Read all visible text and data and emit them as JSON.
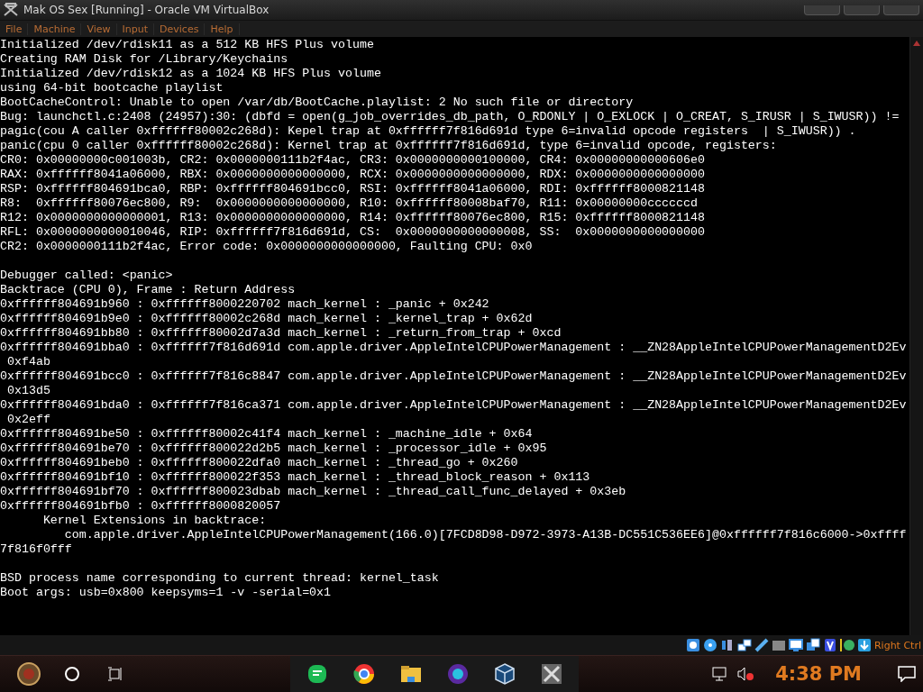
{
  "window": {
    "title": "Mak OS Sex [Running] - Oracle VM VirtualBox"
  },
  "menu": [
    "File",
    "Machine",
    "View",
    "Input",
    "Devices",
    "Help"
  ],
  "console": {
    "blocks": [
      [
        "Initialized /dev/rdisk11 as a 512 KB HFS Plus volume",
        "Creating RAM Disk for /Library/Keychains",
        "Initialized /dev/rdisk12 as a 1024 KB HFS Plus volume",
        "using 64-bit bootcache playlist",
        "BootCacheControl: Unable to open /var/db/BootCache.playlist: 2 No such file or directory",
        "Bug: launchctl.c:2408 (24957):30: (dbfd = open(g_job_overrides_db_path, O_RDONLY | O_EXLOCK | O_CREAT, S_IRUSR | S_IWUSR)) !=",
        "pagic(cou A caller 0xffffff80002c268d): Kepel trap at 0xffffff7f816d691d type 6=invalid opcode registers  | S_IWUSR)) .",
        "panic(cpu 0 caller 0xffffff80002c268d): Kernel trap at 0xffffff7f816d691d, type 6=invalid opcode, registers:",
        "CR0: 0x00000000c001003b, CR2: 0x0000000111b2f4ac, CR3: 0x0000000000100000, CR4: 0x00000000000606e0",
        "RAX: 0xffffff8041a06000, RBX: 0x0000000000000000, RCX: 0x0000000000000000, RDX: 0x0000000000000000",
        "RSP: 0xffffff804691bca0, RBP: 0xffffff804691bcc0, RSI: 0xffffff8041a06000, RDI: 0xffffff8000821148",
        "R8:  0xffffff80076ec800, R9:  0x0000000000000000, R10: 0xffffff80008baf70, R11: 0x00000000ccccccd",
        "R12: 0x0000000000000001, R13: 0x0000000000000000, R14: 0xffffff80076ec800, R15: 0xffffff8000821148",
        "RFL: 0x0000000000010046, RIP: 0xffffff7f816d691d, CS:  0x0000000000000008, SS:  0x0000000000000000",
        "CR2: 0x0000000111b2f4ac, Error code: 0x0000000000000000, Faulting CPU: 0x0"
      ],
      [
        "Debugger called: <panic>",
        "Backtrace (CPU 0), Frame : Return Address",
        "0xffffff804691b960 : 0xffffff8000220702 mach_kernel : _panic + 0x242",
        "0xffffff804691b9e0 : 0xffffff80002c268d mach_kernel : _kernel_trap + 0x62d",
        "0xffffff804691bb80 : 0xffffff80002d7a3d mach_kernel : _return_from_trap + 0xcd",
        "0xffffff804691bba0 : 0xffffff7f816d691d com.apple.driver.AppleIntelCPUPowerManagement : __ZN28AppleIntelCPUPowerManagementD2Ev",
        " 0xf4ab",
        "0xffffff804691bcc0 : 0xffffff7f816c8847 com.apple.driver.AppleIntelCPUPowerManagement : __ZN28AppleIntelCPUPowerManagementD2Ev",
        " 0x13d5",
        "0xffffff804691bda0 : 0xffffff7f816ca371 com.apple.driver.AppleIntelCPUPowerManagement : __ZN28AppleIntelCPUPowerManagementD2Ev",
        " 0x2eff",
        "0xffffff804691be50 : 0xffffff80002c41f4 mach_kernel : _machine_idle + 0x64",
        "0xffffff804691be70 : 0xffffff800022d2b5 mach_kernel : _processor_idle + 0x95",
        "0xffffff804691beb0 : 0xffffff800022dfa0 mach_kernel : _thread_go + 0x260",
        "0xffffff804691bf10 : 0xffffff800022f353 mach_kernel : _thread_block_reason + 0x113",
        "0xffffff804691bf70 : 0xffffff800023dbab mach_kernel : _thread_call_func_delayed + 0x3eb",
        "0xffffff804691bfb0 : 0xffffff8000820057",
        "      Kernel Extensions in backtrace:",
        "         com.apple.driver.AppleIntelCPUPowerManagement(166.0)[7FCD8D98-D972-3973-A13B-DC551C536EE6]@0xffffff7f816c6000->0xffff",
        "7f816f0fff"
      ],
      [
        "BSD process name corresponding to current thread: kernel_task",
        "Boot args: usb=0x800 keepsyms=1 -v -serial=0x1"
      ]
    ]
  },
  "status_bar": {
    "host_key": "Right Ctrl"
  },
  "taskbar": {
    "time": "4:38 PM"
  }
}
